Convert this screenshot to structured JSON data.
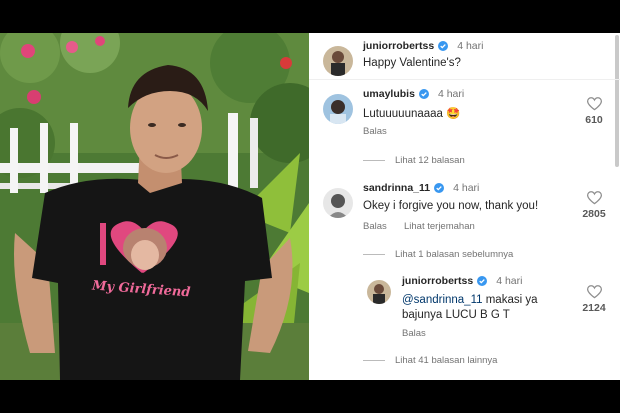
{
  "post": {
    "shirt_text": "My Girlfriend",
    "shirt_letter": "I"
  },
  "caption": {
    "username": "juniorrobertss",
    "time": "4 hari",
    "text": "Happy Valentine's?"
  },
  "comments": [
    {
      "username": "umaylubis",
      "time": "4 hari",
      "text": "Lutuuuuunaaaa 🤩",
      "reply_label": "Balas",
      "likes": "610",
      "thread_label": "Lihat 12 balasan"
    },
    {
      "username": "sandrinna_11",
      "time": "4 hari",
      "text": "Okey i forgive you now, thank you!",
      "reply_label": "Balas",
      "translate_label": "Lihat terjemahan",
      "likes": "2805",
      "thread_label": "Lihat 1 balasan sebelumnya"
    }
  ],
  "reply": {
    "username": "juniorrobertss",
    "time": "4 hari",
    "mention": "@sandrinna_11",
    "text": " makasi ya bajunya LUCU  B G T",
    "reply_label": "Balas",
    "likes": "2124",
    "thread_label": "Lihat 41 balasan lainnya"
  },
  "colors": {
    "verified": "#3897f0",
    "mention": "#00376b",
    "shirt": "#111111",
    "heart_pink": "#e0487f"
  }
}
